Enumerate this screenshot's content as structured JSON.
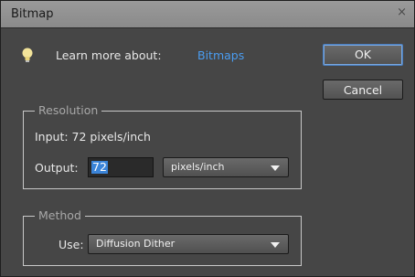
{
  "window": {
    "title": "Bitmap",
    "close_glyph": "×"
  },
  "hint": {
    "label": "Learn more about:",
    "link": "Bitmaps",
    "icon": "lightbulb-icon"
  },
  "buttons": {
    "ok": "OK",
    "cancel": "Cancel"
  },
  "resolution": {
    "group_label": "Resolution",
    "input_text": "Input:  72 pixels/inch",
    "output_label": "Output:",
    "output_value": "72",
    "unit_selected": "pixels/inch"
  },
  "method": {
    "group_label": "Method",
    "use_label": "Use:",
    "use_selected": "Diffusion Dither"
  },
  "colors": {
    "link": "#4a9cf0",
    "selection": "#3b84d8",
    "dialog_bg": "#464646"
  }
}
